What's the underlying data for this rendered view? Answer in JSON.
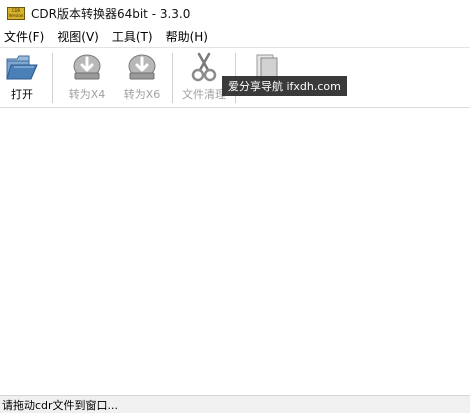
{
  "window": {
    "title": "CDR版本转换器64bit - 3.3.0",
    "logo_text_top": "CDR",
    "logo_text_bottom": "Version"
  },
  "menu": [
    {
      "label": "文件(F)"
    },
    {
      "label": "视图(V)"
    },
    {
      "label": "工具(T)"
    },
    {
      "label": "帮助(H)"
    }
  ],
  "toolbar": {
    "open": {
      "label": "打开",
      "icon": "folder-open-icon",
      "enabled": true
    },
    "convert_x4": {
      "label": "转为X4",
      "icon": "convert-icon",
      "enabled": false
    },
    "convert_x6": {
      "label": "转为X6",
      "icon": "convert-icon",
      "enabled": false
    },
    "clear": {
      "label": "文件清理",
      "icon": "scissors-icon",
      "enabled": false
    },
    "export": {
      "label": "",
      "icon": "document-icon",
      "enabled": false
    }
  },
  "watermark": {
    "text": "爱分享导航 ifxdh.com"
  },
  "status": {
    "text": "请拖动cdr文件到窗口..."
  },
  "colors": {
    "accent_folder": "#4a7fb8",
    "disabled_icon": "#8c8c8c",
    "logo": "#d8b22a"
  }
}
